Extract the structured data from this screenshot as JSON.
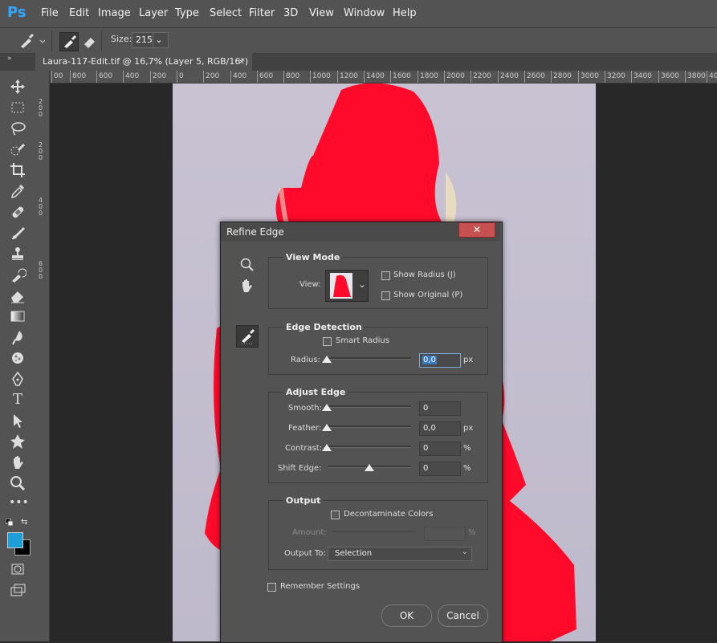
{
  "app": {
    "logo": "Ps"
  },
  "menu": [
    "File",
    "Edit",
    "Image",
    "Layer",
    "Type",
    "Select",
    "Filter",
    "3D",
    "View",
    "Window",
    "Help"
  ],
  "options": {
    "size_label": "Size:",
    "size_value": "215",
    "dropdown_icon": "chevron-down-icon"
  },
  "document_tab": {
    "title": "Laura-117-Edit.tif @ 16,7% (Layer 5, RGB/16*)",
    "close": "×"
  },
  "ruler": {
    "h_ticks": [
      "00",
      "800",
      "600",
      "400",
      "200",
      "0",
      "200",
      "400",
      "600",
      "800",
      "1000",
      "1200",
      "1400",
      "1600",
      "1800",
      "2000",
      "2200",
      "2400",
      "2600",
      "2800",
      "3000",
      "3200",
      "3400",
      "3600",
      "3800",
      "40"
    ],
    "v_ticks": [
      "2",
      "0",
      "0",
      "2",
      "0",
      "0",
      "4",
      "0",
      "0",
      "6",
      "0",
      "0"
    ]
  },
  "dialog": {
    "title": "Refine Edge",
    "close": "✕",
    "view_mode": {
      "title": "View Mode",
      "view_label": "View:",
      "show_radius": "Show Radius (J)",
      "show_original": "Show Original (P)"
    },
    "edge_detection": {
      "title": "Edge Detection",
      "smart_radius": "Smart Radius",
      "radius_label": "Radius:",
      "radius_value": "0,0",
      "radius_unit": "px"
    },
    "adjust_edge": {
      "title": "Adjust Edge",
      "smooth_label": "Smooth:",
      "smooth_value": "0",
      "feather_label": "Feather:",
      "feather_value": "0,0",
      "feather_unit": "px",
      "contrast_label": "Contrast:",
      "contrast_value": "0",
      "contrast_unit": "%",
      "shift_label": "Shift Edge:",
      "shift_value": "0",
      "shift_unit": "%"
    },
    "output": {
      "title": "Output",
      "decontaminate": "Decontaminate Colors",
      "amount_label": "Amount:",
      "amount_unit": "%",
      "output_to_label": "Output To:",
      "output_to_value": "Selection"
    },
    "remember": "Remember Settings",
    "ok": "OK",
    "cancel": "Cancel"
  },
  "colors": {
    "ui": "#535353",
    "canvas_bg": "#282828",
    "photo_bg": "#c4bfd0",
    "mask_red": "#ff0a2a",
    "fg_swatch": "#1e9ed6",
    "ps_blue": "#31a8ff"
  }
}
